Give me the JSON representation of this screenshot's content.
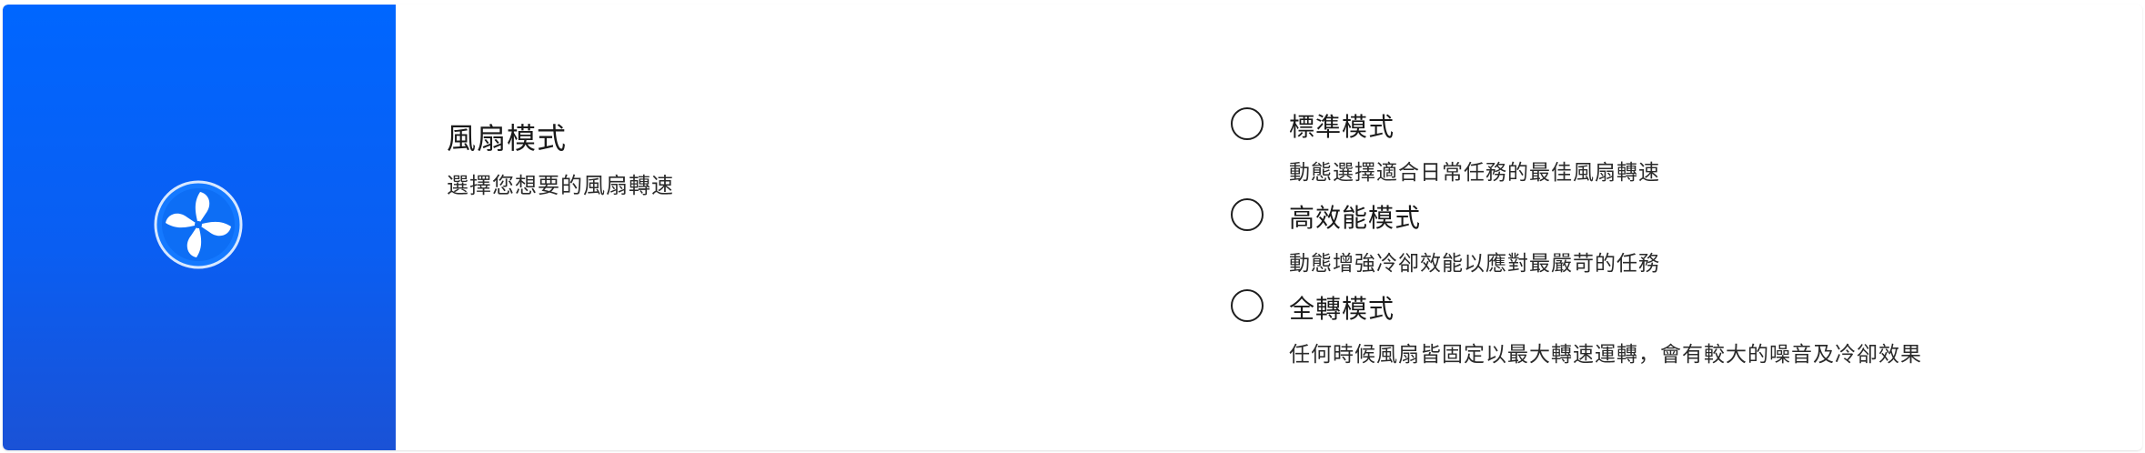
{
  "fan_mode": {
    "title": "風扇模式",
    "subtitle": "選擇您想要的風扇轉速",
    "icon": "fan-icon",
    "accent_color": "#0066ff",
    "options": [
      {
        "label": "標準模式",
        "description": "動態選擇適合日常任務的最佳風扇轉速",
        "selected": false
      },
      {
        "label": "高效能模式",
        "description": "動態增強冷卻效能以應對最嚴苛的任務",
        "selected": false
      },
      {
        "label": "全轉模式",
        "description": "任何時候風扇皆固定以最大轉速運轉，會有較大的噪音及冷卻效果",
        "selected": false
      }
    ]
  }
}
